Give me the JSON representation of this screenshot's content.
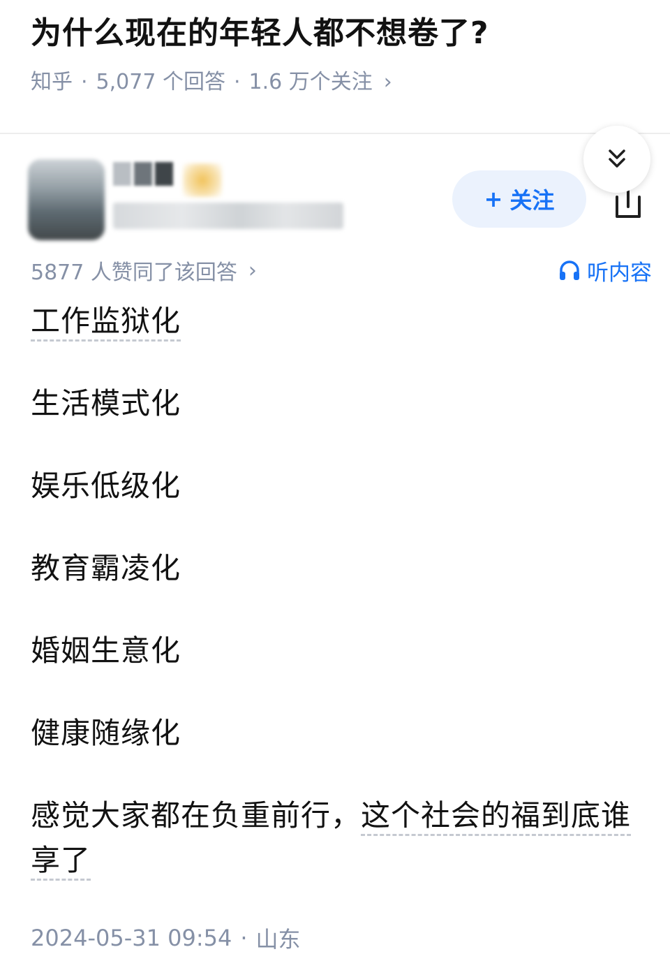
{
  "question": {
    "title": "为什么现在的年轻人都不想卷了?",
    "source": "知乎",
    "answers": "5,077 个回答",
    "followers": "1.6 万个关注",
    "separator": "·",
    "chevron": "›"
  },
  "author": {
    "name": "",
    "description": "",
    "follow_plus": "+",
    "follow_label": "关注"
  },
  "answer": {
    "votes": "5877 人赞同了该回答",
    "chevron": "›",
    "listen_label": "听内容",
    "lines": {
      "l0": "工作监狱化",
      "l1": "生活模式化",
      "l2": "娱乐低级化",
      "l3": "教育霸凌化",
      "l4": "婚姻生意化",
      "l5": "健康随缘化",
      "l6a": "感觉大家都在负重前行，",
      "l6b": "这个社会的福到底谁享了"
    },
    "date": "2024-05-31 09:54",
    "separator": "·",
    "location": "山东"
  },
  "colors": {
    "accent": "#1772f6",
    "follow_bg": "#ebf2fd",
    "meta_gray": "#8590a6",
    "text": "#121212"
  },
  "icons": {
    "collapse": "double-chevron-down-icon",
    "share": "share-icon",
    "headphones": "headphones-icon"
  }
}
